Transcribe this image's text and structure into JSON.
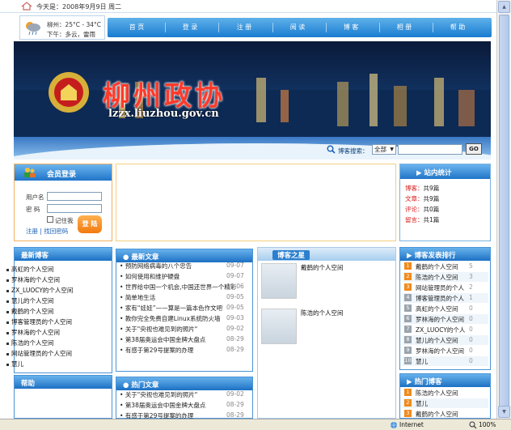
{
  "topbar": {
    "date_text": "今天是：2008年9月9日 周二"
  },
  "weather": {
    "line1": "柳州：25°C - 34°C",
    "line2": "下午：多云，雷雨"
  },
  "nav": {
    "items": [
      "首 页",
      "登 录",
      "注 册",
      "阅 读",
      "博 客",
      "相 册",
      "帮 助"
    ]
  },
  "banner": {
    "title": "柳州政协",
    "url": "lzzx.liuzhou.gov.cn"
  },
  "search": {
    "label": "博客搜索：",
    "scope": "全部",
    "button": "GO"
  },
  "login": {
    "title": "会员登录",
    "username_label": "用户名",
    "password_label": "密  码",
    "remember_label": "记住我",
    "login_button": "登 陆",
    "register_link": "注册",
    "forgot_link": "找回密码"
  },
  "stats": {
    "title": "站内统计",
    "rows": [
      {
        "k": "博客：",
        "v": "共9篇"
      },
      {
        "k": "文章：",
        "v": "共9篇"
      },
      {
        "k": "评论：",
        "v": "共0篇"
      },
      {
        "k": "留言：",
        "v": "共1篇"
      }
    ]
  },
  "newest_blogs": {
    "title": "最新博客",
    "items": [
      "高虹的个人空间",
      "罗林海的个人空间",
      "ZX_LUOCY的个人空间",
      "慧儿的个人空间",
      "戴鹤的个人空间",
      "博客管理员的个人空间",
      "罗林海的个人空间",
      "陈浩的个人空间",
      "网站管理员的个人空间",
      "慧儿"
    ]
  },
  "help": {
    "title": "帮助"
  },
  "newest_articles": {
    "title": "最新文章",
    "items": [
      {
        "t": "预防网络病毒的八个忠告",
        "d": "09-07"
      },
      {
        "t": "如何使用和维护硬盘",
        "d": "09-07"
      },
      {
        "t": "世界给中国一个机会,中国还世界一个精彩",
        "d": "09-06"
      },
      {
        "t": "简单地生活",
        "d": "09-05"
      },
      {
        "t": "家有“娃娃”——算是一篇本色作文吧",
        "d": "09-05"
      },
      {
        "t": "教你完全免费自建Linux系统防火墙",
        "d": "09-03"
      },
      {
        "t": "关于\"央视也难见到的照片\"",
        "d": "09-02"
      },
      {
        "t": "第38届奥运会中国金牌大盘点",
        "d": "08-29"
      },
      {
        "t": "有感于第29号提案的办理",
        "d": "08-29"
      }
    ]
  },
  "hot_articles": {
    "title": "热门文章",
    "items": [
      {
        "t": "关于\"央视也难见到的照片\"",
        "d": "09-02"
      },
      {
        "t": "第38届奥运会中国金牌大盘点",
        "d": "08-29"
      },
      {
        "t": "有感于第29号提案的办理",
        "d": "08-29"
      }
    ]
  },
  "blog_stars": {
    "title": "博客之星",
    "items": [
      "戴鹤的个人空间",
      "陈浩的个人空间"
    ]
  },
  "ranking": {
    "title": "博客发表排行",
    "items": [
      {
        "n": "1",
        "name": "戴鹤的个人空间",
        "c": "5"
      },
      {
        "n": "2",
        "name": "陈浩的个人空间",
        "c": "3"
      },
      {
        "n": "3",
        "name": "网站管理员的个人",
        "c": "2"
      },
      {
        "n": "4",
        "name": "博客管理员的个人",
        "c": "1"
      },
      {
        "n": "5",
        "name": "高虹的个人空间",
        "c": "0"
      },
      {
        "n": "6",
        "name": "罗林海的个人空间",
        "c": "0"
      },
      {
        "n": "7",
        "name": "ZX_LUOCY的个人",
        "c": "0"
      },
      {
        "n": "8",
        "name": "慧儿的个人空间",
        "c": "0"
      },
      {
        "n": "9",
        "name": "罗林海的个人空间",
        "c": "0"
      },
      {
        "n": "10",
        "name": "慧儿",
        "c": "0"
      }
    ]
  },
  "hot_blogs": {
    "title": "热门博客",
    "items": [
      {
        "n": "1",
        "name": "陈浩的个人空间"
      },
      {
        "n": "2",
        "name": "慧儿"
      },
      {
        "n": "3",
        "name": "戴鹤的个人空间"
      }
    ]
  },
  "statusbar": {
    "zone": "Internet",
    "zoom": "100%"
  }
}
